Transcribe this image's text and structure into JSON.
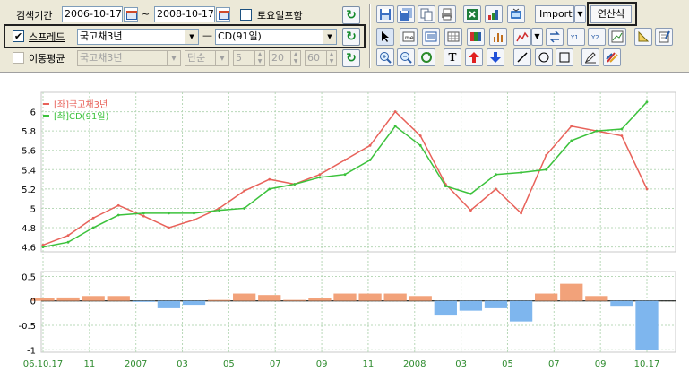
{
  "search": {
    "label": "검색기간",
    "start_date": "2006-10-17",
    "range_sep": "~",
    "end_date": "2008-10-17",
    "saturday_include_label": "토요일포함",
    "saturday_checked": false
  },
  "spread": {
    "checked": true,
    "label": "스프레드",
    "series1": "국고채3년",
    "dash": "—",
    "series2": "CD(91일)"
  },
  "moving_avg": {
    "checked": false,
    "label": "이동평균",
    "series": "국고채3년",
    "method": "단순",
    "period1": "5",
    "period2": "20",
    "period3": "60"
  },
  "toolbar": {
    "import_label": "Import",
    "formula_label": "연산식",
    "text_tool_label": "T"
  },
  "colors": {
    "series1": "#e8625a",
    "series2": "#3cc23c",
    "spread_positive": "#f2a27a",
    "spread_negative": "#7eb6ee",
    "grid": "#b8d8b8",
    "axis_text_x": "#2e8b2e"
  },
  "chart_data": [
    {
      "type": "line",
      "legend_position": "top-left",
      "grid": true,
      "series": [
        {
          "name": "[좌]국고채3년"
        },
        {
          "name": "[좌]CD(91일)"
        }
      ],
      "y_ticks": [
        "4.6",
        "4.8",
        "5",
        "5.2",
        "5.4",
        "5.6",
        "5.8",
        "6"
      ],
      "ylim": [
        4.55,
        6.2
      ],
      "x_tick_labels": [
        "06.10.17",
        "11",
        "2007",
        "03",
        "05",
        "07",
        "09",
        "11",
        "2008",
        "03",
        "05",
        "07",
        "09",
        "10.17"
      ],
      "x": [
        "2006-10",
        "2006-11",
        "2006-12",
        "2007-01",
        "2007-02",
        "2007-03",
        "2007-04",
        "2007-05",
        "2007-06",
        "2007-07",
        "2007-08",
        "2007-09",
        "2007-10",
        "2007-11",
        "2007-12",
        "2008-01",
        "2008-02",
        "2008-03",
        "2008-04",
        "2008-05",
        "2008-06",
        "2008-07",
        "2008-08",
        "2008-09",
        "2008-10"
      ],
      "series1_values": [
        4.62,
        4.72,
        4.9,
        5.03,
        4.92,
        4.8,
        4.88,
        5.0,
        5.18,
        5.3,
        5.25,
        5.35,
        5.5,
        5.65,
        6.0,
        5.75,
        5.25,
        4.98,
        5.2,
        4.95,
        5.55,
        5.85,
        5.8,
        5.75,
        5.2
      ],
      "series2_values": [
        4.6,
        4.65,
        4.8,
        4.93,
        4.95,
        4.95,
        4.95,
        4.98,
        5.0,
        5.2,
        5.25,
        5.32,
        5.35,
        5.5,
        5.85,
        5.65,
        5.23,
        5.15,
        5.35,
        5.37,
        5.4,
        5.7,
        5.8,
        5.82,
        6.1
      ]
    },
    {
      "type": "area",
      "series": [
        {
          "name": ""
        }
      ],
      "y_ticks": [
        "0.5",
        "0",
        "-0.5",
        "-1"
      ],
      "ylim": [
        -1.05,
        0.6
      ],
      "x": [
        "2006-10",
        "2006-11",
        "2006-12",
        "2007-01",
        "2007-02",
        "2007-03",
        "2007-04",
        "2007-05",
        "2007-06",
        "2007-07",
        "2007-08",
        "2007-09",
        "2007-10",
        "2007-11",
        "2007-12",
        "2008-01",
        "2008-02",
        "2008-03",
        "2008-04",
        "2008-05",
        "2008-06",
        "2008-07",
        "2008-08",
        "2008-09",
        "2008-10"
      ],
      "values": [
        0.05,
        0.07,
        0.1,
        0.1,
        -0.02,
        -0.15,
        -0.08,
        0.02,
        0.15,
        0.12,
        0.02,
        0.05,
        0.15,
        0.15,
        0.15,
        0.1,
        -0.3,
        -0.2,
        -0.15,
        -0.42,
        0.15,
        0.35,
        0.1,
        -0.1,
        -1.0
      ]
    }
  ]
}
